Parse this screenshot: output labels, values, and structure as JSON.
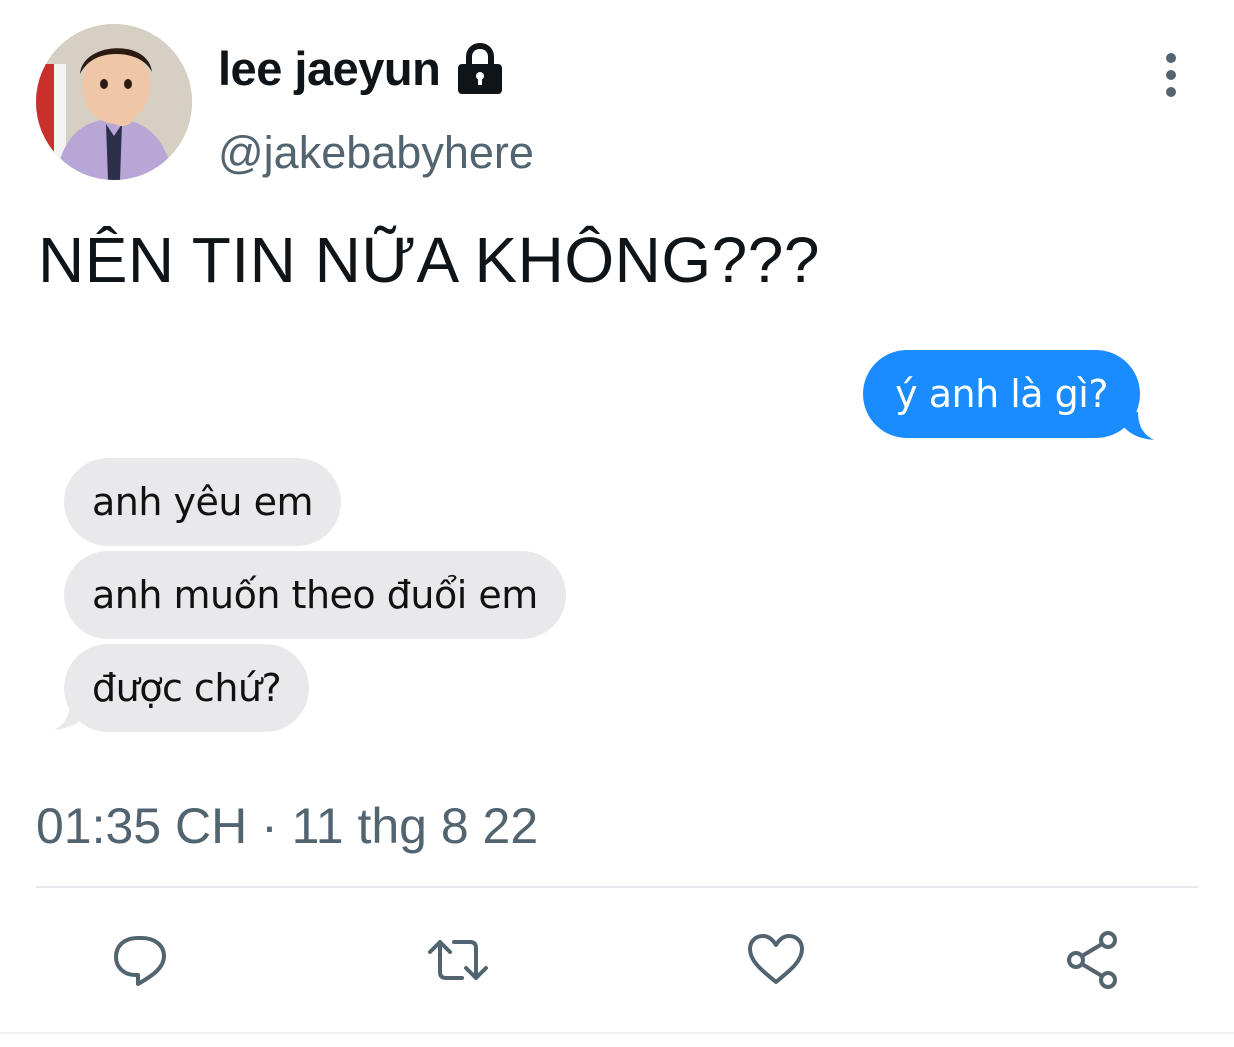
{
  "author": {
    "display_name": "lee jaeyun",
    "handle": "@jakebabyhere",
    "avatar_icon": "child-portrait-avatar",
    "protected_icon": "lock-icon"
  },
  "tweet": {
    "text": "NÊN TIN NỮA KHÔNG???",
    "timestamp": "01:35 CH · 11 thg 8 22"
  },
  "media": {
    "messages": [
      {
        "direction": "sent",
        "text": "ý anh là gì?"
      },
      {
        "direction": "received",
        "text": "anh yêu em"
      },
      {
        "direction": "received",
        "text": "anh muốn theo đuổi em"
      },
      {
        "direction": "received",
        "text": "được chứ?"
      }
    ],
    "colors": {
      "sent_bubble": "#1a8cff",
      "received_bubble": "#e9e9eb"
    }
  },
  "actions": {
    "icons": [
      "reply-icon",
      "retweet-icon",
      "like-icon",
      "share-icon"
    ],
    "more_icon": "more-options-icon"
  },
  "colors": {
    "text_primary": "#0f1419",
    "text_secondary": "#536471",
    "icon": "#536471"
  }
}
